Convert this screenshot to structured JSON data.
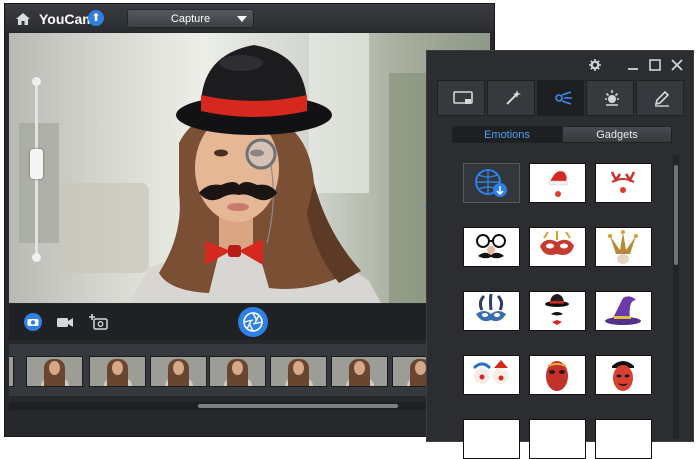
{
  "app": {
    "title": "YouCam",
    "home_icon": "home-icon",
    "update_icon": "upload-arrow-icon",
    "mode_select": {
      "value": "Capture"
    }
  },
  "toolbar": {
    "icons": [
      "camera-icon",
      "video-icon",
      "add-photo-icon",
      "shutter-icon"
    ]
  },
  "filmstrip": {
    "thumbnail_count": 7
  },
  "effects_panel": {
    "window_controls": [
      "gear-icon",
      "minimize-icon",
      "maximize-icon",
      "close-icon"
    ],
    "tabs": [
      "scene-tab",
      "magic-wand-tab",
      "avatar-tab",
      "distortion-tab",
      "brush-tab"
    ],
    "active_tab": 2,
    "subtabs": [
      "Emotions",
      "Gadgets"
    ],
    "active_subtab": 0,
    "items": [
      "download-more",
      "santa-hat",
      "antlers",
      "glasses-mustache",
      "carnival-mask",
      "jester-hat",
      "feather-mask",
      "bowler-hat",
      "witch-hat",
      "clowns",
      "venetian-mask",
      "opera-mask"
    ]
  },
  "colors": {
    "accent": "#2d80e6",
    "chrome": "#26282c",
    "hat_band": "#d6281f"
  }
}
